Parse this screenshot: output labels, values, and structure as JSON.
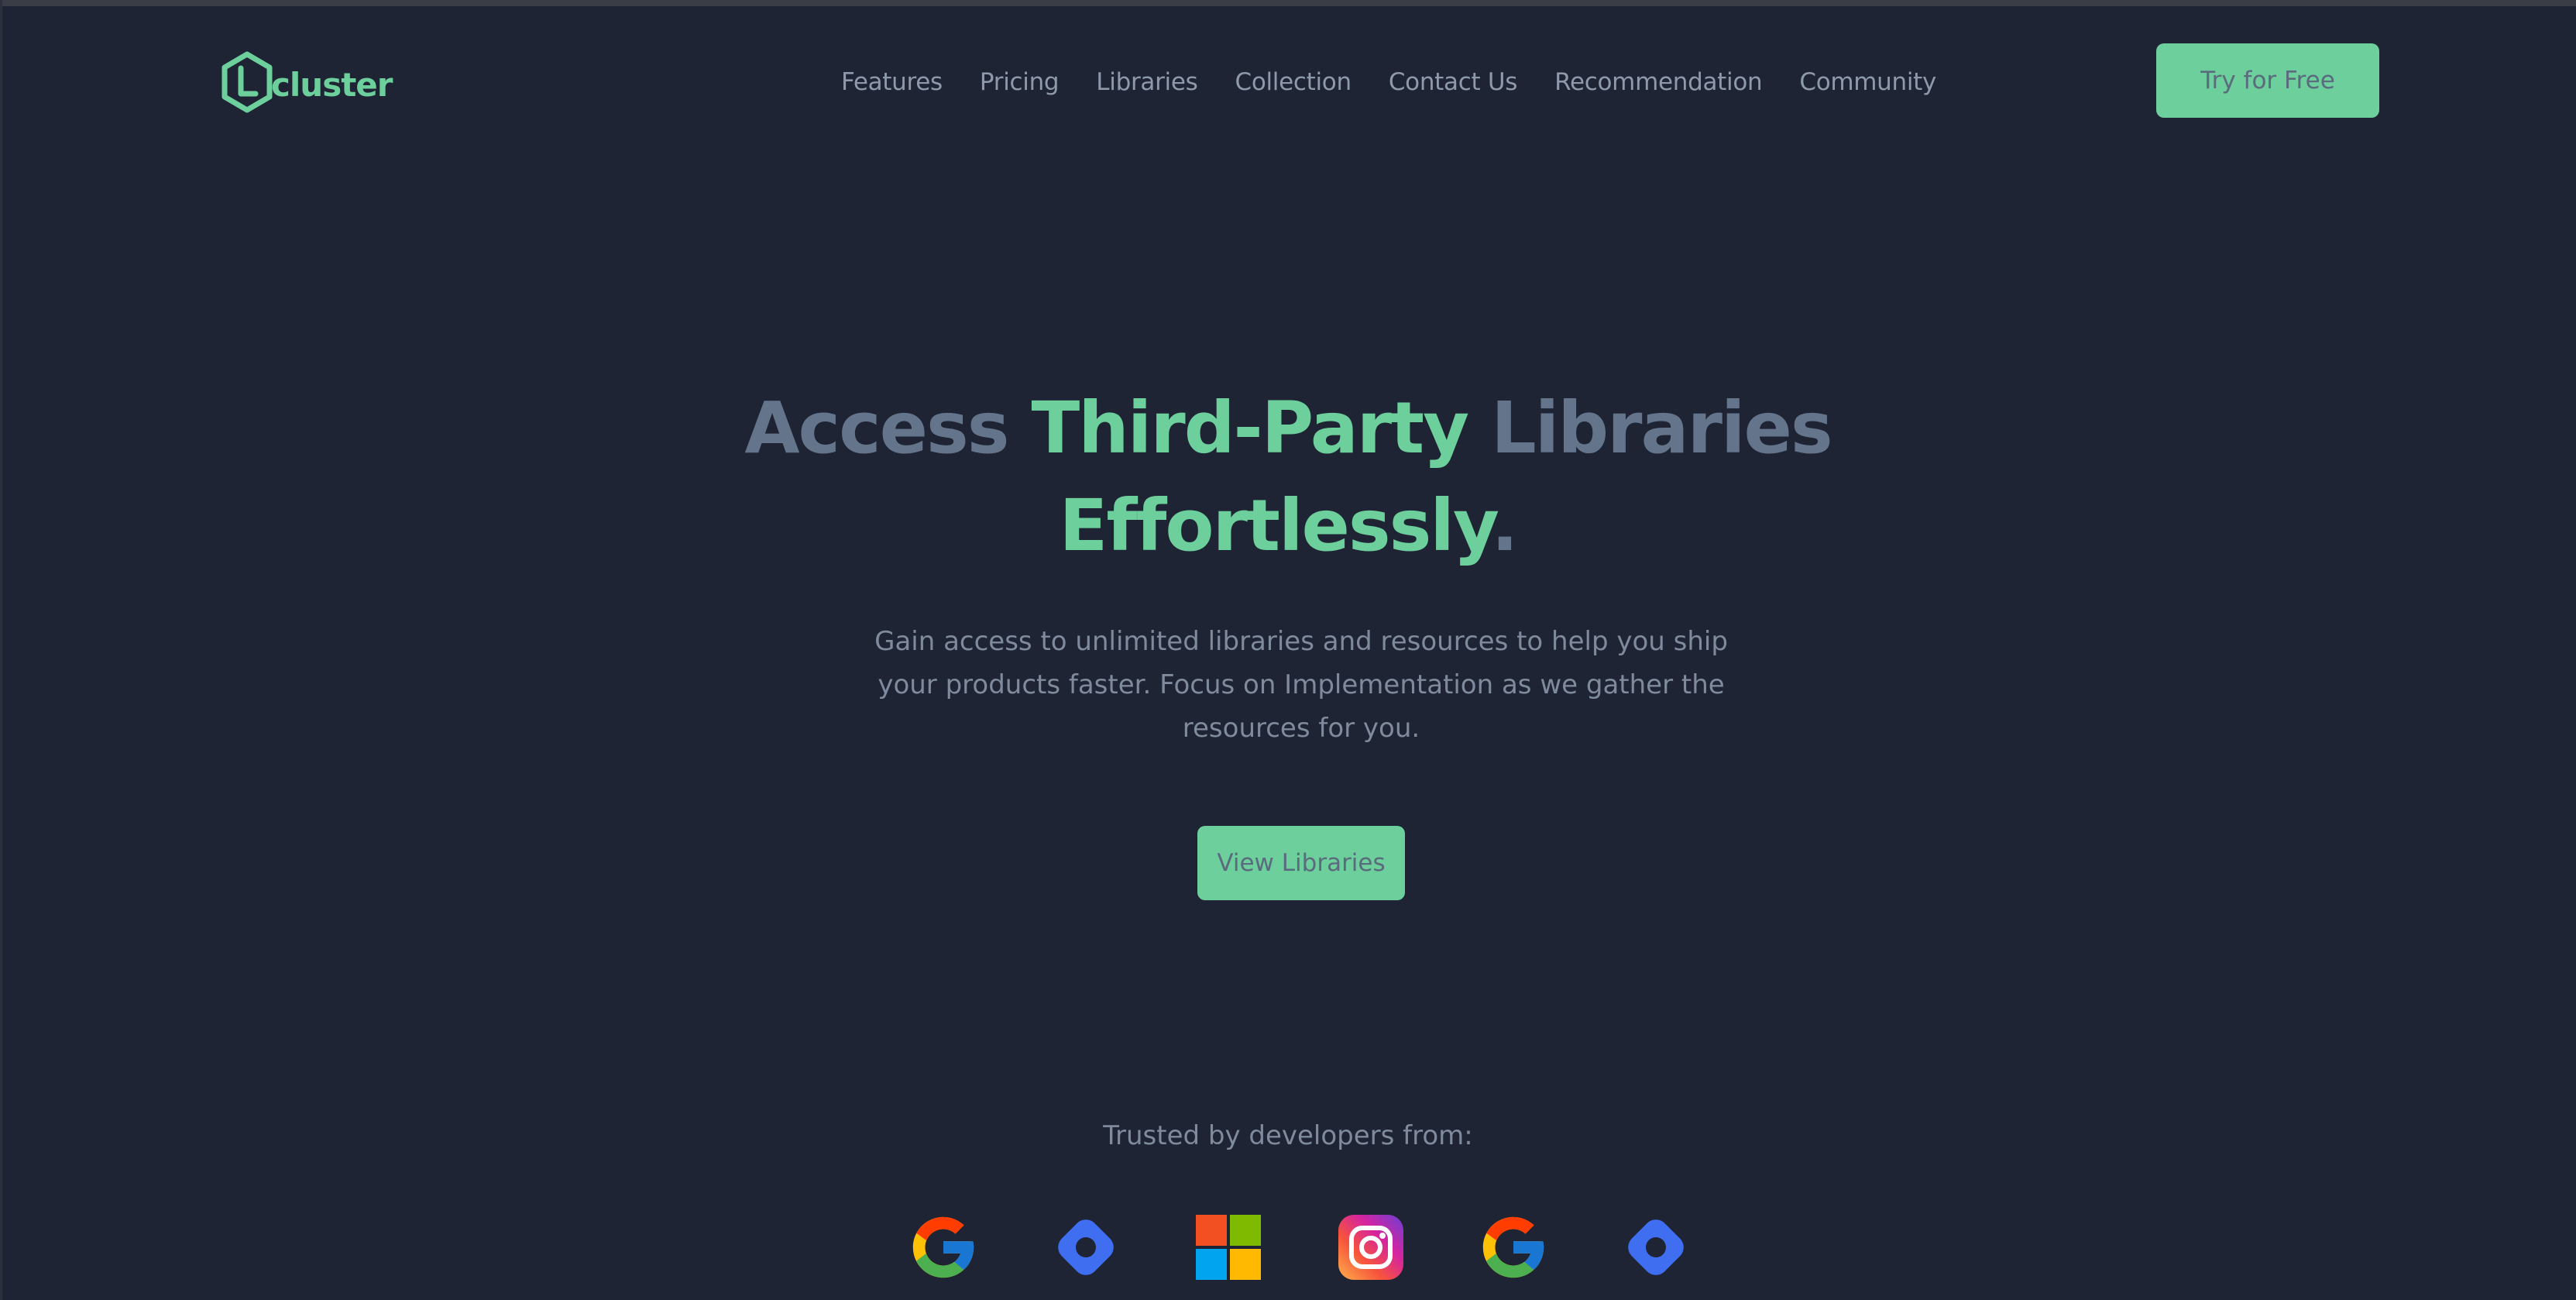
{
  "header": {
    "logo": {
      "icon": "hexagon-l-icon",
      "text": "cluster",
      "color": "#6ccf9c"
    },
    "nav": [
      {
        "label": "Features"
      },
      {
        "label": "Pricing"
      },
      {
        "label": "Libraries"
      },
      {
        "label": "Collection"
      },
      {
        "label": "Contact Us"
      },
      {
        "label": "Recommendation"
      },
      {
        "label": "Community"
      }
    ],
    "cta_label": "Try for Free"
  },
  "hero": {
    "title_part1": "Access ",
    "title_part2": "Third-Party",
    "title_part3": " Libraries",
    "title_part4": "Effortlessly",
    "title_part5": ".",
    "subtitle": "Gain access to unlimited libraries and resources to help you ship your products faster. Focus on Implementation as we gather the resources for you.",
    "button_label": "View Libraries"
  },
  "trusted": {
    "label": "Trusted by developers from:",
    "brands": [
      {
        "icon": "google-icon"
      },
      {
        "icon": "diamond-ring-icon"
      },
      {
        "icon": "microsoft-icon"
      },
      {
        "icon": "instagram-icon"
      },
      {
        "icon": "google-icon"
      },
      {
        "icon": "diamond-ring-icon"
      }
    ]
  },
  "colors": {
    "background": "#1e2433",
    "accent": "#6ccf9c",
    "muted_heading": "#64748b",
    "nav_text": "#8e99ab"
  }
}
